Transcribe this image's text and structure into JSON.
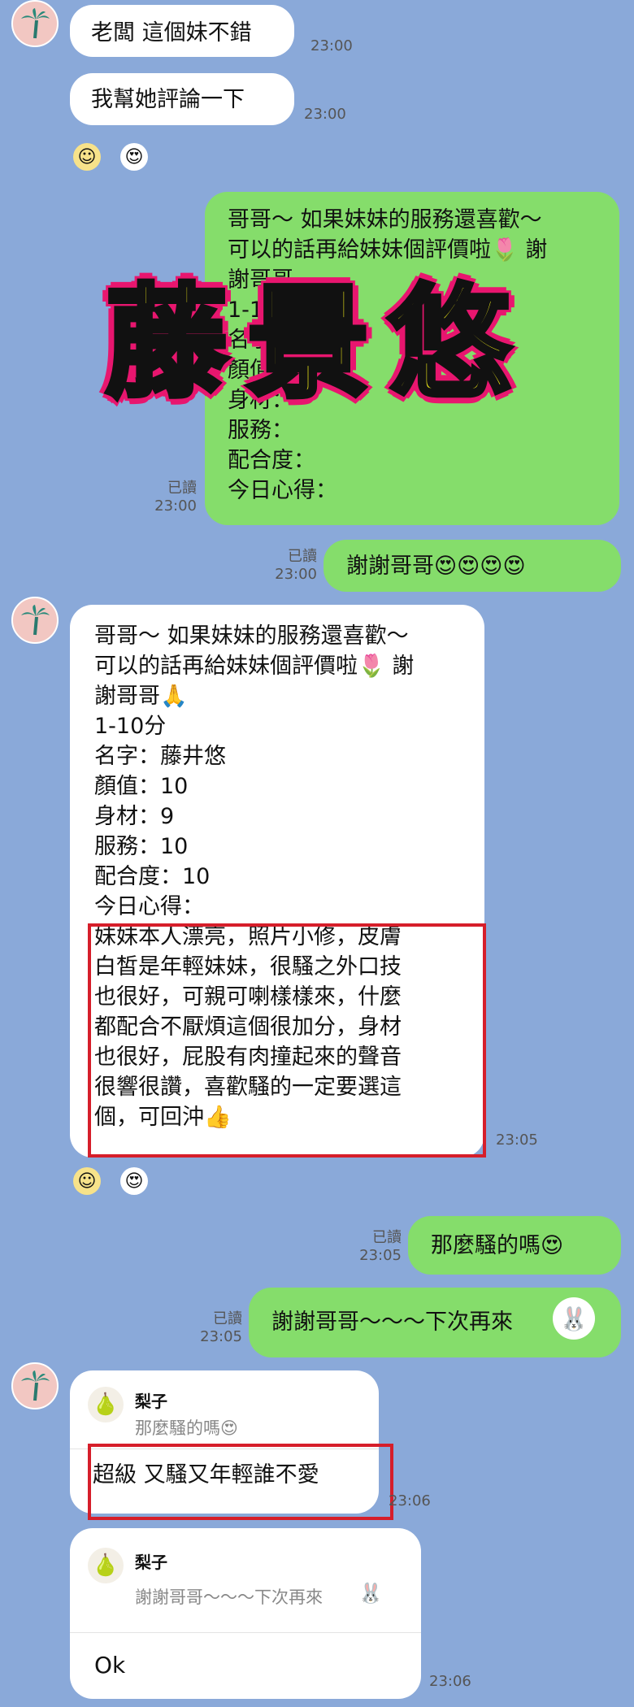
{
  "colors": {
    "background": "#8aa9d9",
    "incoming_bubble": "#ffffff",
    "outgoing_bubble": "#85dd6b",
    "highlight_box": "#d61e2a",
    "watermark_fill": "#f5ef18",
    "watermark_glow": "#e8166f"
  },
  "watermark": "藤景悠",
  "messages": {
    "m1": {
      "text": "老闆 這個妹不錯",
      "time": "23:00"
    },
    "m2": {
      "text": "我幫她評論一下",
      "time": "23:00"
    },
    "m3": {
      "lines": [
        "哥哥～ 如果妹妹的服務還喜歡～",
        "可以的話再給妹妹個評價啦🌷 謝",
        "謝哥哥",
        "1-10分",
        "名字：",
        "顏值：",
        "身材：",
        "服務：",
        "配合度：",
        "今日心得："
      ],
      "read": "已讀",
      "time": "23:00"
    },
    "m4": {
      "text": "謝謝哥哥😍😍😍😍",
      "read": "已讀",
      "time": "23:00"
    },
    "m5": {
      "lines": [
        "哥哥～ 如果妹妹的服務還喜歡～",
        "可以的話再給妹妹個評價啦🌷 謝",
        "謝哥哥🙏",
        "1-10分",
        "名字：藤井悠",
        "顏值：10",
        "身材：9",
        "服務：10",
        "配合度：10",
        "今日心得："
      ],
      "review_lines": [
        "妹妹本人漂亮，照片小修，皮膚",
        "白皙是年輕妹妹，很騷之外口技",
        "也很好，可親可喇樣樣來，什麼",
        "都配合不厭煩這個很加分，身材",
        "也很好，屁股有肉撞起來的聲音",
        "很響很讚，喜歡騷的一定要選這",
        "個，可回沖👍"
      ],
      "time": "23:05"
    },
    "m6": {
      "text": "那麼騷的嗎😍",
      "read": "已讀",
      "time": "23:05"
    },
    "m7": {
      "text": "謝謝哥哥～～～下次再來",
      "read": "已讀",
      "time": "23:05"
    },
    "m8": {
      "reply_name": "梨子",
      "reply_quote": "那麼騷的嗎😍",
      "text": "超級 又騷又年輕誰不愛",
      "time": "23:06"
    },
    "m9": {
      "reply_name": "梨子",
      "reply_quote": "謝謝哥哥～～～下次再來",
      "text": "Ok",
      "time": "23:06"
    }
  },
  "icons": {
    "avatar": "palm-tree-icon",
    "react_smile": "smile-face-icon",
    "react_heart": "heart-eyes-icon",
    "reply_avatar": "pear-icon",
    "sticker": "bunny-sticker-icon"
  }
}
